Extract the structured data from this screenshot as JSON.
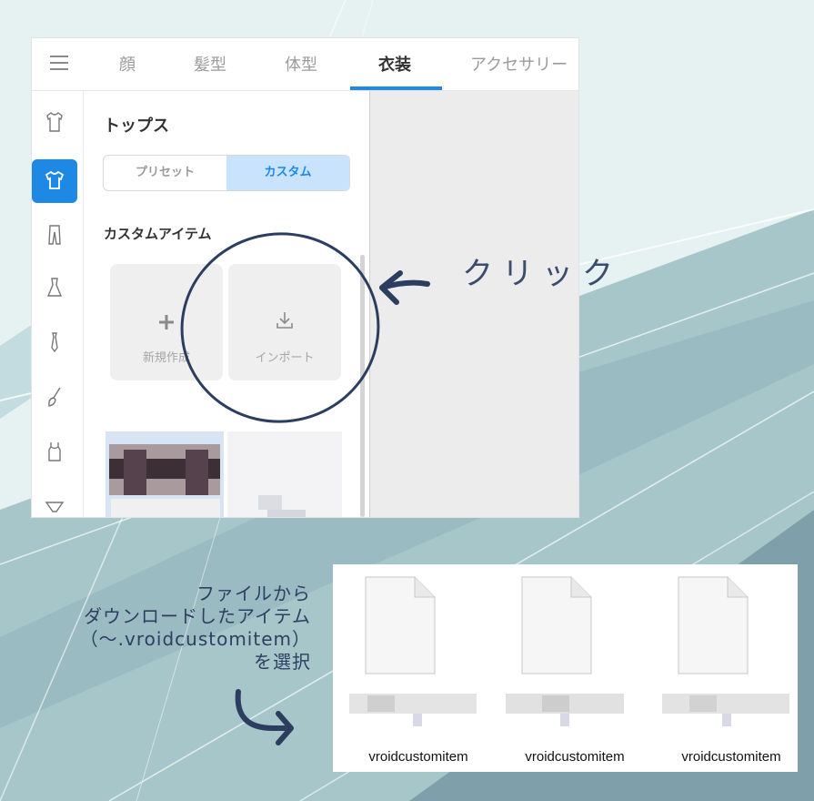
{
  "tabs": [
    {
      "label": "顔"
    },
    {
      "label": "髪型"
    },
    {
      "label": "体型"
    },
    {
      "label": "衣装"
    },
    {
      "label": "アクセサリー"
    }
  ],
  "active_tab": "衣装",
  "accent_color": "#1e88e5",
  "sidebar_icons": [
    "shirt-outline-icon",
    "tshirt-icon",
    "pants-icon",
    "dress-icon",
    "tie-icon",
    "brush-icon",
    "tank-top-icon",
    "underwear-icon"
  ],
  "content": {
    "title": "トップス",
    "segment": {
      "preset": "プリセット",
      "custom": "カスタム",
      "selected": "カスタム"
    },
    "section_title": "カスタムアイテム",
    "new_tile": {
      "label": "新規作成",
      "icon": "plus-icon"
    },
    "import_tile": {
      "label": "インポート",
      "icon": "download-icon"
    }
  },
  "annotation": {
    "click": "クリック",
    "lines": [
      "ファイルから",
      "ダウンロードしたアイテム",
      "（～.vroidcustomitem）",
      "を選択"
    ]
  },
  "files": [
    {
      "name": "vroidcustomitem"
    },
    {
      "name": "vroidcustomitem"
    },
    {
      "name": "vroidcustomitem"
    }
  ]
}
